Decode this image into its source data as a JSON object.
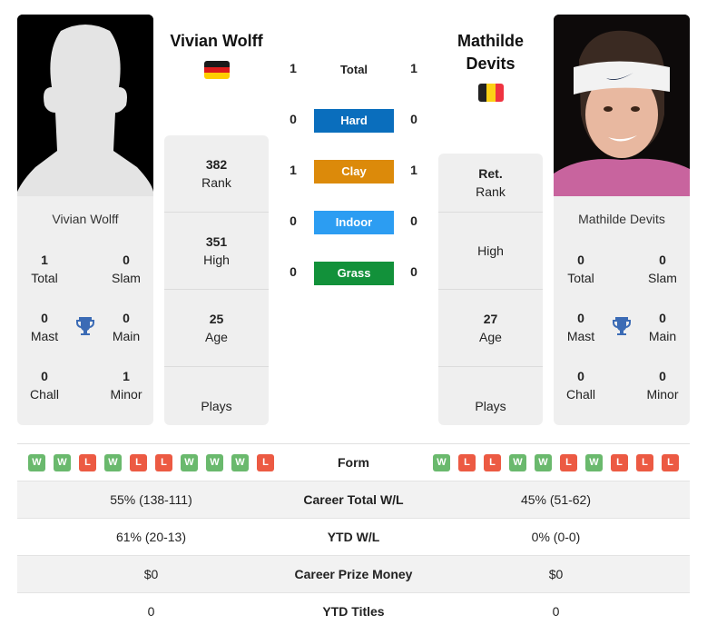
{
  "player1": {
    "name": "Vivian Wolff",
    "card_name": "Vivian Wolff",
    "flag": "germany",
    "flag_colors": [
      "#1a1a1a",
      "#dd1c1c",
      "#ffce00"
    ],
    "titles": {
      "total": {
        "value": "1",
        "label": "Total"
      },
      "slam": {
        "value": "0",
        "label": "Slam"
      },
      "mast": {
        "value": "0",
        "label": "Mast"
      },
      "main": {
        "value": "0",
        "label": "Main"
      },
      "chall": {
        "value": "0",
        "label": "Chall"
      },
      "minor": {
        "value": "1",
        "label": "Minor"
      }
    },
    "stats": [
      {
        "value": "382",
        "label": "Rank"
      },
      {
        "value": "351",
        "label": "High"
      },
      {
        "value": "25",
        "label": "Age"
      },
      {
        "value": "",
        "label": "Plays"
      }
    ],
    "form": [
      "W",
      "W",
      "L",
      "W",
      "L",
      "L",
      "W",
      "W",
      "W",
      "L"
    ]
  },
  "player2": {
    "name_line1": "Mathilde",
    "name_line2": "Devits",
    "card_name": "Mathilde Devits",
    "flag": "belgium",
    "flag_colors": [
      "#222222",
      "#fcd116",
      "#ef3340"
    ],
    "titles": {
      "total": {
        "value": "0",
        "label": "Total"
      },
      "slam": {
        "value": "0",
        "label": "Slam"
      },
      "mast": {
        "value": "0",
        "label": "Mast"
      },
      "main": {
        "value": "0",
        "label": "Main"
      },
      "chall": {
        "value": "0",
        "label": "Chall"
      },
      "minor": {
        "value": "0",
        "label": "Minor"
      }
    },
    "stats": [
      {
        "value": "Ret.",
        "label": "Rank"
      },
      {
        "value": "",
        "label": "High"
      },
      {
        "value": "27",
        "label": "Age"
      },
      {
        "value": "",
        "label": "Plays"
      }
    ],
    "form": [
      "W",
      "L",
      "L",
      "W",
      "W",
      "L",
      "W",
      "L",
      "L",
      "L"
    ]
  },
  "h2h": {
    "total": {
      "label": "Total",
      "p1": "1",
      "p2": "1"
    },
    "surfaces": [
      {
        "label": "Hard",
        "p1": "0",
        "p2": "0",
        "color": "#0a6ebd"
      },
      {
        "label": "Clay",
        "p1": "1",
        "p2": "1",
        "color": "#dc8a0a"
      },
      {
        "label": "Indoor",
        "p1": "0",
        "p2": "0",
        "color": "#2c9df2"
      },
      {
        "label": "Grass",
        "p1": "0",
        "p2": "0",
        "color": "#12913a"
      }
    ]
  },
  "form_label": "Form",
  "comparison": [
    {
      "label": "Career Total W/L",
      "p1": "55% (138-111)",
      "p2": "45% (51-62)"
    },
    {
      "label": "YTD W/L",
      "p1": "61% (20-13)",
      "p2": "0% (0-0)"
    },
    {
      "label": "Career Prize Money",
      "p1": "$0",
      "p2": "$0"
    },
    {
      "label": "YTD Titles",
      "p1": "0",
      "p2": "0"
    }
  ],
  "colors": {
    "trophy": "#3b6bb5",
    "win": "#6ab96d",
    "loss": "#ec5a43"
  }
}
